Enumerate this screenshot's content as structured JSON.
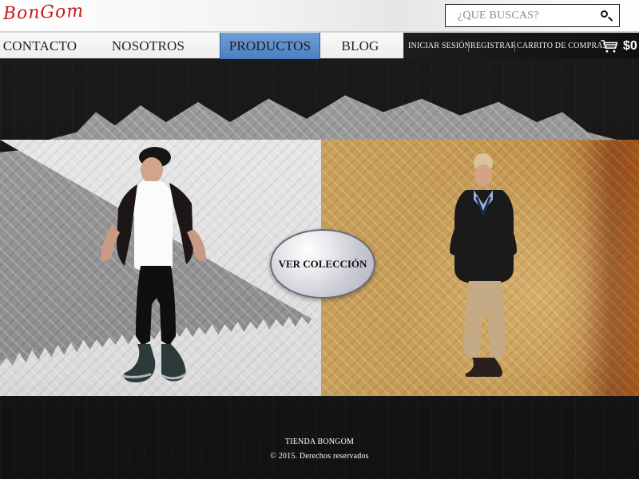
{
  "header": {
    "logo_text": "BonGom",
    "search": {
      "placeholder": "¿QUE BUSCAS?",
      "value": ""
    }
  },
  "nav": {
    "items": [
      {
        "label": "CONTACTO"
      },
      {
        "label": "NOSOTROS"
      },
      {
        "label": "PRODUCTOS",
        "active": true
      },
      {
        "label": "BLOG"
      }
    ],
    "utilities": {
      "login": "INICIAR SESIÓN",
      "register": "REGISTRAR",
      "cart_label": "CARRITO DE COMPRAS",
      "cart_total": "$0"
    }
  },
  "hero": {
    "cta_label": "VER COLECCIÓN"
  },
  "footer": {
    "store_name": "TIENDA BONGOM",
    "copyright": "© 2015. Derechos reservados"
  },
  "colors": {
    "nav_active": "#4b7fc0",
    "logo_red": "#c41c1c",
    "hero_right": "#c79a52"
  },
  "icons": {
    "search": "search-icon",
    "cart": "shopping-cart-icon"
  }
}
